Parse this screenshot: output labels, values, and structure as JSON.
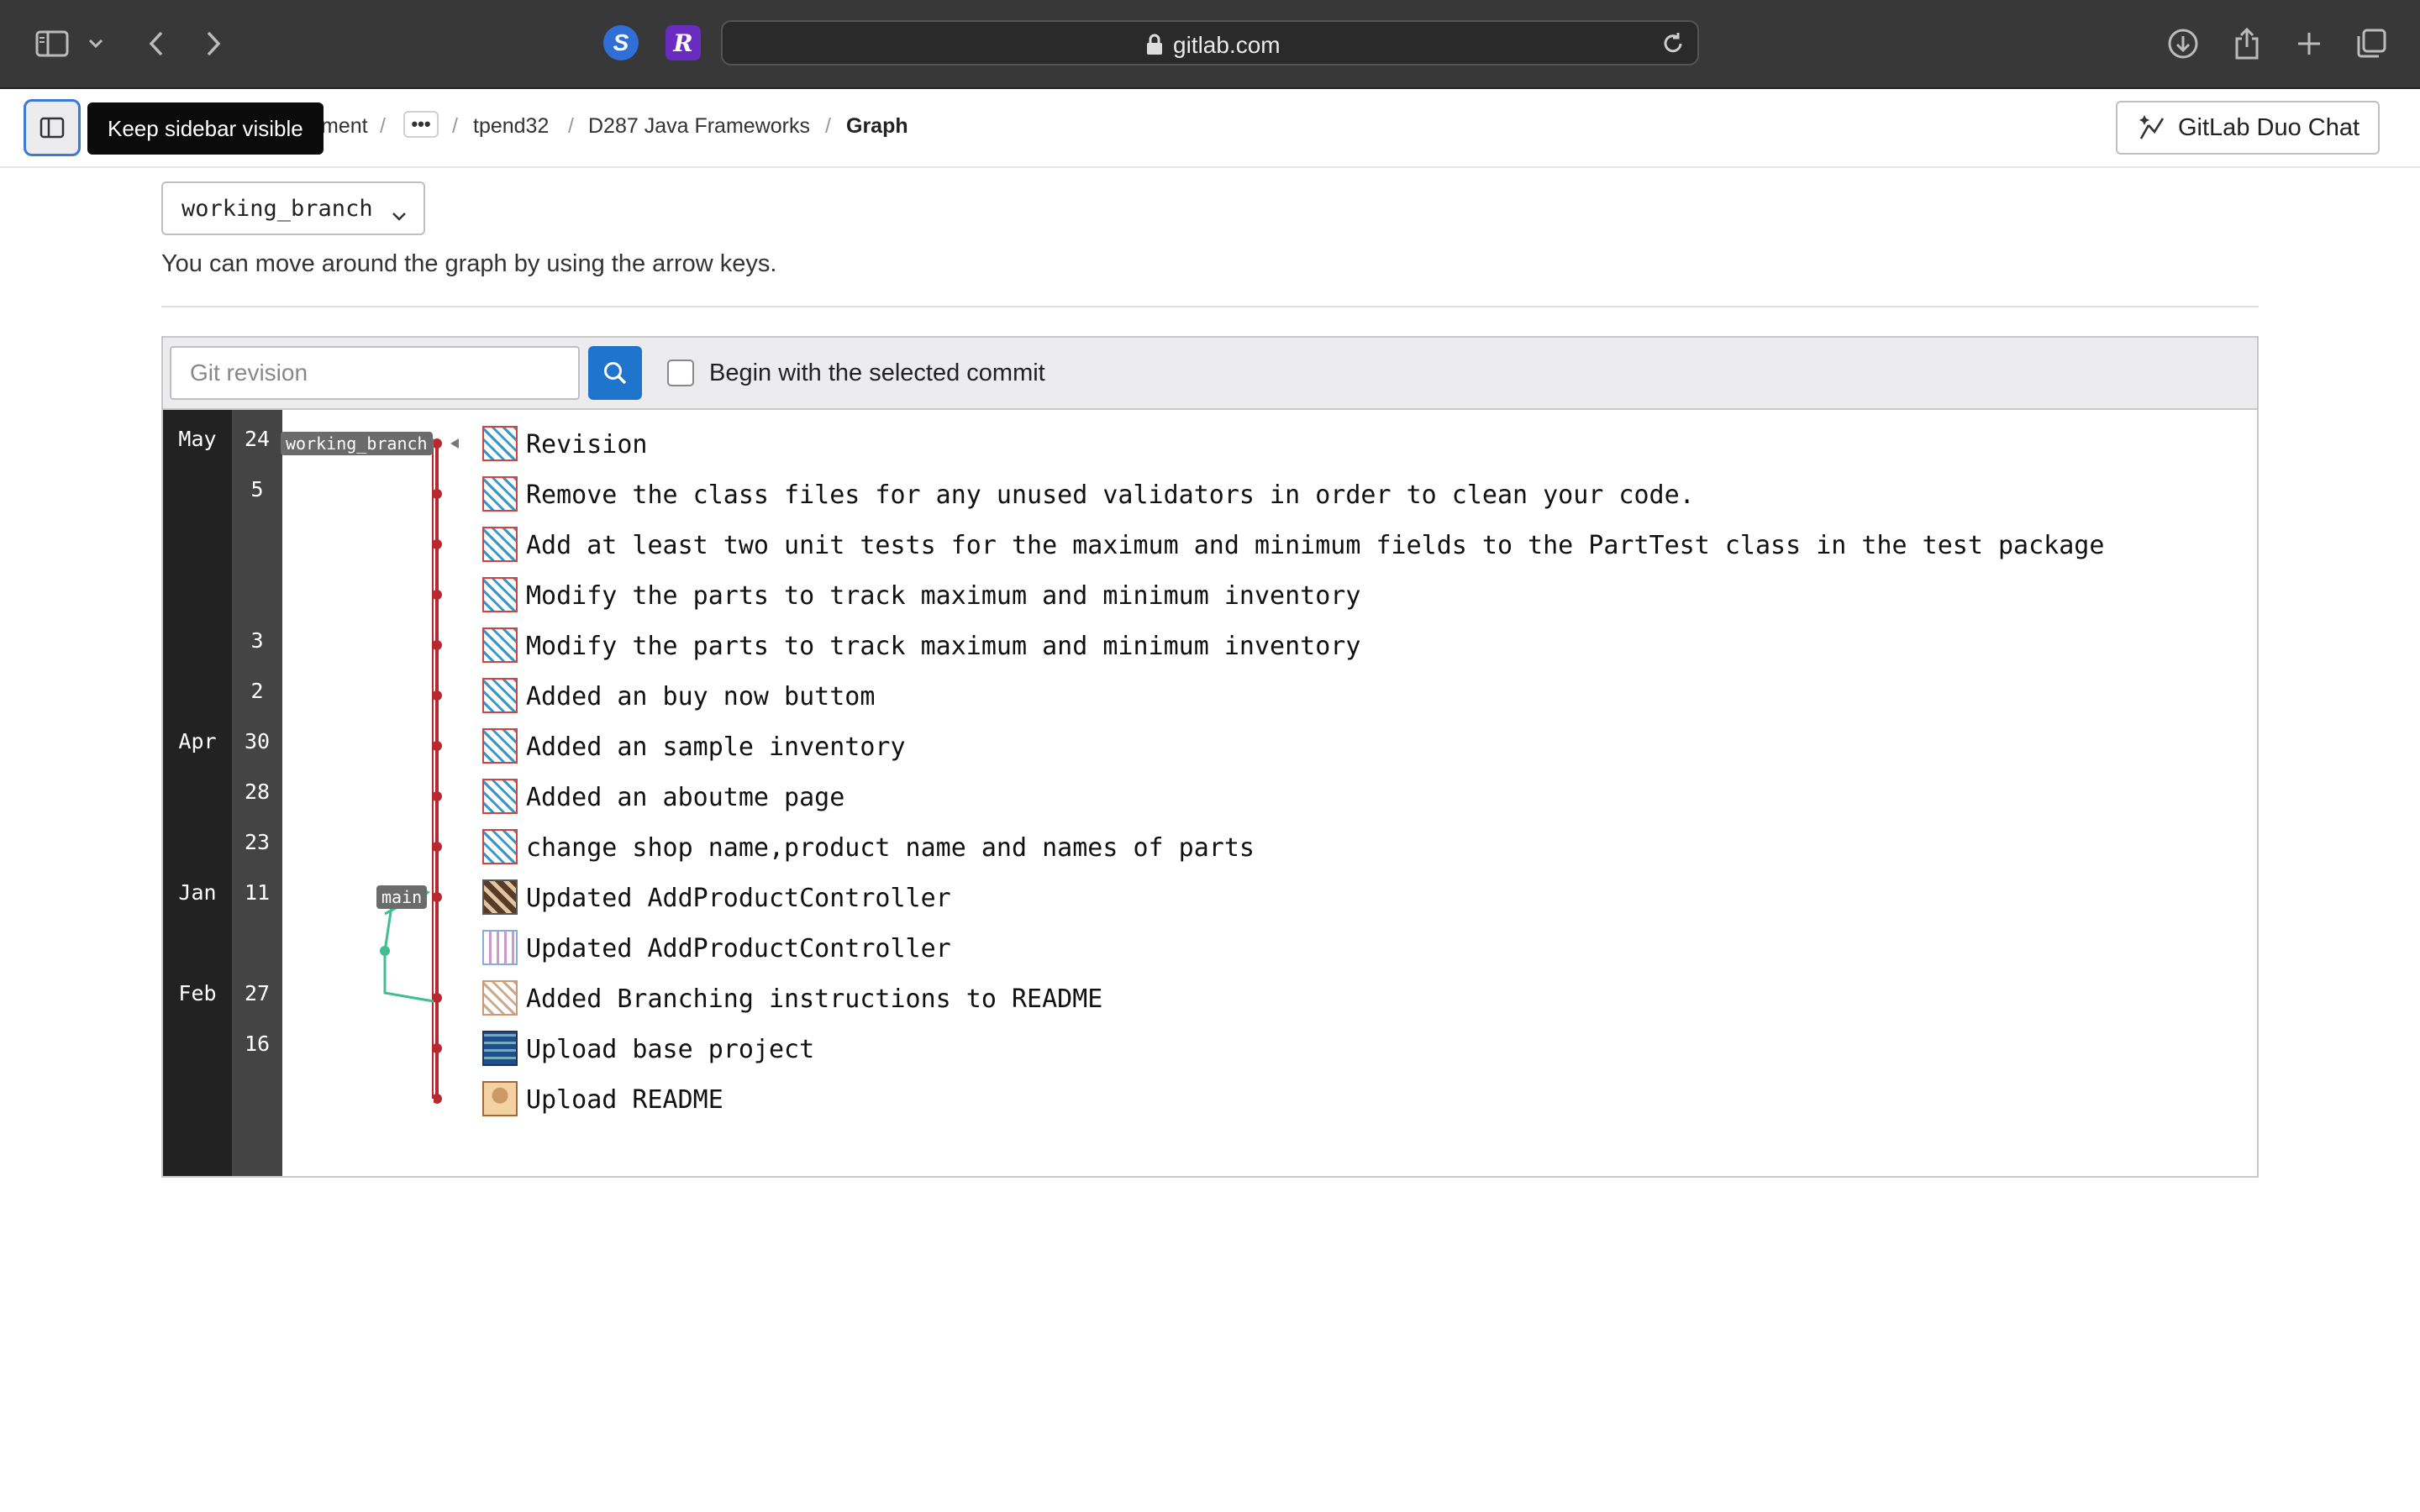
{
  "browser": {
    "url_host": "gitlab.com",
    "extensions": [
      "S",
      "R"
    ],
    "icons": [
      "sidebar-icon",
      "chevron-down-icon",
      "back-icon",
      "forward-icon",
      "lock-icon",
      "reload-icon",
      "download-icon",
      "share-icon",
      "plus-icon",
      "tabs-icon"
    ]
  },
  "header": {
    "tooltip": "Keep sidebar visible",
    "breadcrumbs": {
      "partial": "ment",
      "ellipsis": "•••",
      "user": "tpend32",
      "project": "D287 Java Frameworks",
      "current": "Graph",
      "sep": "/"
    },
    "duo_button": "GitLab Duo Chat"
  },
  "branch_select": {
    "value": "working_branch"
  },
  "hint": "You can move around the graph by using the arrow keys.",
  "filter": {
    "placeholder": "Git revision",
    "checkbox_label": "Begin with the selected commit",
    "checked": false
  },
  "graph": {
    "refs": [
      "working_branch",
      "main"
    ],
    "months": [
      "May",
      "Apr",
      "Jan",
      "Feb"
    ],
    "days": [
      "24",
      "5",
      "3",
      "2",
      "30",
      "28",
      "23",
      "11",
      "27",
      "16"
    ],
    "commits": [
      "Revision",
      "Remove the class files for any unused validators in order to clean your code.",
      "Add at least two unit tests for the maximum and minimum fields to the PartTest class in the test package",
      "Modify the parts to track maximum and minimum inventory",
      "Modify the parts to track maximum and minimum inventory",
      "Added an buy now buttom",
      "Added an sample inventory",
      "Added an aboutme page",
      "change shop name,product name and names of parts",
      "Updated AddProductController",
      "Updated AddProductController",
      "Added Branching instructions to README",
      "Upload base project",
      "Upload README"
    ],
    "colors": {
      "main_line": "#b9282f",
      "branch_line": "#3fbf8f"
    }
  }
}
